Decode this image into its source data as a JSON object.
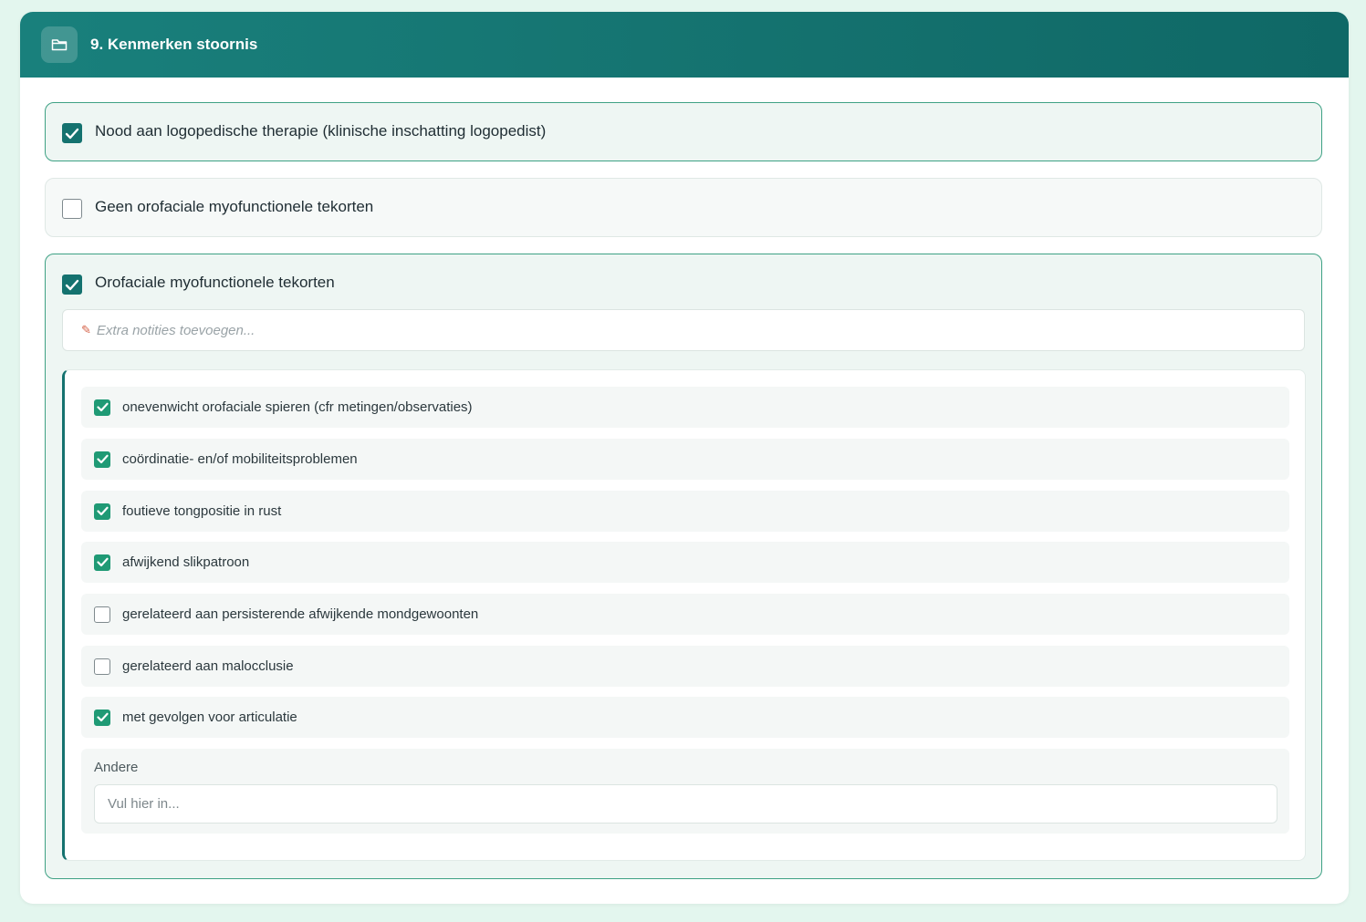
{
  "section": {
    "icon": "folder-icon",
    "title": "9. Kenmerken stoornis"
  },
  "options": [
    {
      "label": "Nood aan logopedische therapie (klinische inschatting logopedist)",
      "checked": true
    },
    {
      "label": "Geen orofaciale myofunctionele tekorten",
      "checked": false
    },
    {
      "label": "Orofaciale myofunctionele tekorten",
      "checked": true
    }
  ],
  "notes": {
    "icon": "pencil-memo-icon",
    "placeholder": "Extra notities toevoegen..."
  },
  "sub_items": [
    {
      "label": "onevenwicht orofaciale spieren (cfr metingen/observaties)",
      "checked": true
    },
    {
      "label": "coördinatie- en/of mobiliteitsproblemen",
      "checked": true
    },
    {
      "label": "foutieve tongpositie in rust",
      "checked": true
    },
    {
      "label": "afwijkend slikpatroon",
      "checked": true
    },
    {
      "label": "gerelateerd aan persisterende afwijkende mondgewoonten",
      "checked": false
    },
    {
      "label": "gerelateerd aan malocclusie",
      "checked": false
    },
    {
      "label": "met gevolgen voor articulatie",
      "checked": true
    }
  ],
  "andere": {
    "label": "Andere",
    "placeholder": "Vul hier in..."
  },
  "colors": {
    "header": "#14716e",
    "checkbox_primary": "#14726f",
    "checkbox_secondary": "#1f9a75",
    "background": "#e3f6ee"
  }
}
